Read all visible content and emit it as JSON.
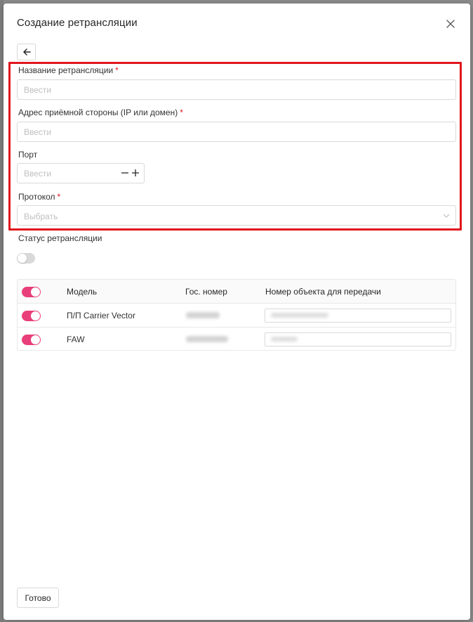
{
  "modal": {
    "title": "Создание ретрансляции",
    "close_icon": "close-icon",
    "back_icon": "arrow-left-icon"
  },
  "form": {
    "name": {
      "label": "Название ретрансляции",
      "required": "*",
      "placeholder": "Ввести",
      "value": ""
    },
    "address": {
      "label": "Адрес приёмной стороны (IP или домен)",
      "required": "*",
      "placeholder": "Ввести",
      "value": ""
    },
    "port": {
      "label": "Порт",
      "placeholder": "Ввести",
      "value": "",
      "minus_icon": "minus-icon",
      "plus_icon": "plus-icon"
    },
    "protocol": {
      "label": "Протокол",
      "required": "*",
      "placeholder": "Выбрать",
      "arrow_icon": "chevron-down-icon"
    },
    "status": {
      "label": "Статус ретрансляции",
      "enabled": false
    }
  },
  "table": {
    "columns": [
      "Модель",
      "Гос. номер",
      "Номер объекта для передачи"
    ],
    "header_toggle_on": true,
    "rows": [
      {
        "enabled": true,
        "model": "П/П Carrier Vector",
        "plate": "",
        "object_number": ""
      },
      {
        "enabled": true,
        "model": "FAW",
        "plate": "",
        "object_number": ""
      }
    ]
  },
  "footer": {
    "done_label": "Готово"
  },
  "colors": {
    "accent": "#e83e7a",
    "highlight": "#e0161e",
    "required": "#e0161e"
  }
}
